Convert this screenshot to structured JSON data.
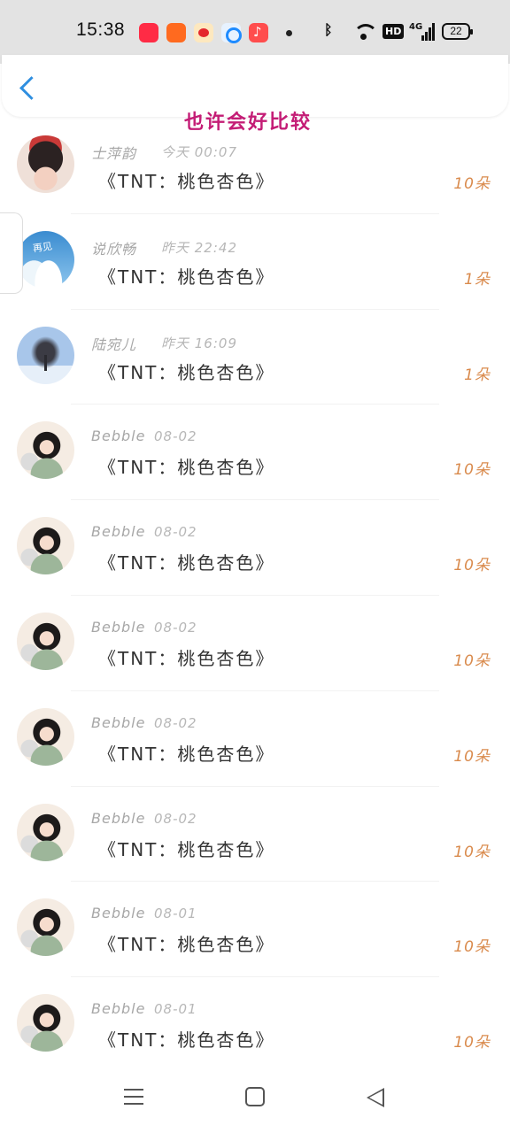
{
  "status_bar": {
    "time": "15:38",
    "network": "4G",
    "hd": "HD",
    "battery": "22"
  },
  "header": {
    "title": "也许会好比较"
  },
  "gifts": [
    {
      "user": "士萍韵",
      "time": "今天 00:07",
      "gift": "《TNT：桃色杏色》",
      "count": "10朵",
      "avatar": "girl-red-beret"
    },
    {
      "user": "说欣畅",
      "time": "昨天 22:42",
      "gift": "《TNT：桃色杏色》",
      "count": "1朵",
      "avatar": "sky-clouds"
    },
    {
      "user": "陆宛儿",
      "time": "昨天 16:09",
      "gift": "《TNT：桃色杏色》",
      "count": "1朵",
      "avatar": "winter-tree"
    },
    {
      "user": "Bebble",
      "time": "08-02",
      "gift": "《TNT：桃色杏色》",
      "count": "10朵",
      "avatar": "girl-illustration"
    },
    {
      "user": "Bebble",
      "time": "08-02",
      "gift": "《TNT：桃色杏色》",
      "count": "10朵",
      "avatar": "girl-illustration"
    },
    {
      "user": "Bebble",
      "time": "08-02",
      "gift": "《TNT：桃色杏色》",
      "count": "10朵",
      "avatar": "girl-illustration"
    },
    {
      "user": "Bebble",
      "time": "08-02",
      "gift": "《TNT：桃色杏色》",
      "count": "10朵",
      "avatar": "girl-illustration"
    },
    {
      "user": "Bebble",
      "time": "08-02",
      "gift": "《TNT：桃色杏色》",
      "count": "10朵",
      "avatar": "girl-illustration"
    },
    {
      "user": "Bebble",
      "time": "08-01",
      "gift": "《TNT：桃色杏色》",
      "count": "10朵",
      "avatar": "girl-illustration"
    },
    {
      "user": "Bebble",
      "time": "08-01",
      "gift": "《TNT：桃色杏色》",
      "count": "10朵",
      "avatar": "girl-illustration"
    }
  ],
  "colors": {
    "title": "#c41d76",
    "back_arrow": "#2f8fe0",
    "count": "#d98a4c",
    "meta": "#a7a7a7"
  },
  "icons": [
    "back-arrow-icon",
    "bluetooth-icon",
    "wifi-icon",
    "signal-icon",
    "battery-icon",
    "menu-icon",
    "home-icon",
    "nav-back-icon"
  ]
}
